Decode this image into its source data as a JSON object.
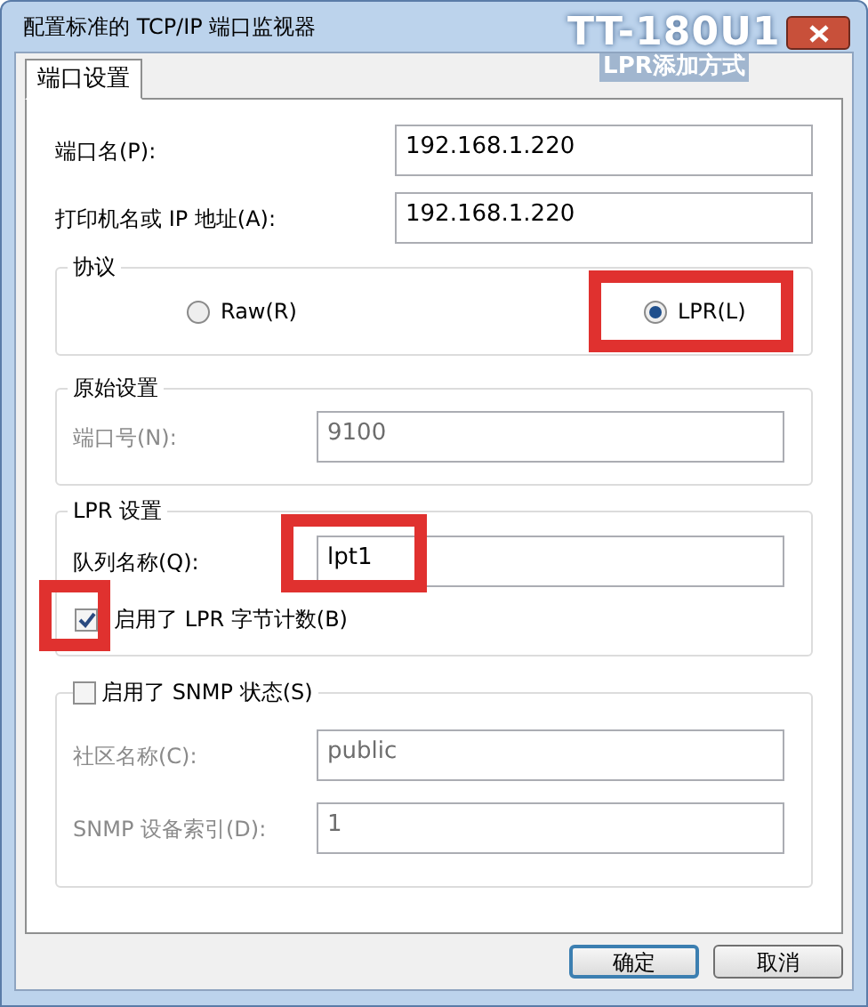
{
  "window": {
    "title": "配置标准的 TCP/IP 端口监视器"
  },
  "annotation": {
    "lines": [
      "TT-180U1",
      "LPR添加方式"
    ]
  },
  "tabs": [
    {
      "label": "端口设置",
      "selected": true
    }
  ],
  "fields": [
    {
      "label": "端口名(P):",
      "value": "192.168.1.220"
    },
    {
      "label": "打印机名或 IP 地址(A):",
      "value": "192.168.1.220"
    }
  ],
  "protocol": {
    "title": "协议",
    "options": [
      {
        "label": "Raw(R)",
        "selected": false,
        "highlighted": false
      },
      {
        "label": "LPR(L)",
        "selected": true,
        "highlighted": true
      }
    ]
  },
  "raw_settings": {
    "title": "原始设置",
    "disabled": true,
    "fields": [
      {
        "label": "端口号(N):",
        "value": "9100"
      }
    ]
  },
  "lpr_settings": {
    "title": "LPR 设置",
    "queue": {
      "label": "队列名称(Q):",
      "value": "lpt1",
      "highlighted": true
    },
    "byte_counting": {
      "label": "启用了 LPR 字节计数(B)",
      "checked": true,
      "highlighted": true
    }
  },
  "snmp": {
    "label": "启用了 SNMP 状态(S)",
    "checked": false,
    "fields": [
      {
        "label": "社区名称(C):",
        "value": "public"
      },
      {
        "label": "SNMP 设备索引(D):",
        "value": "1"
      }
    ]
  },
  "buttons": [
    {
      "label": "确定",
      "default": true
    },
    {
      "label": "取消",
      "default": false
    }
  ]
}
